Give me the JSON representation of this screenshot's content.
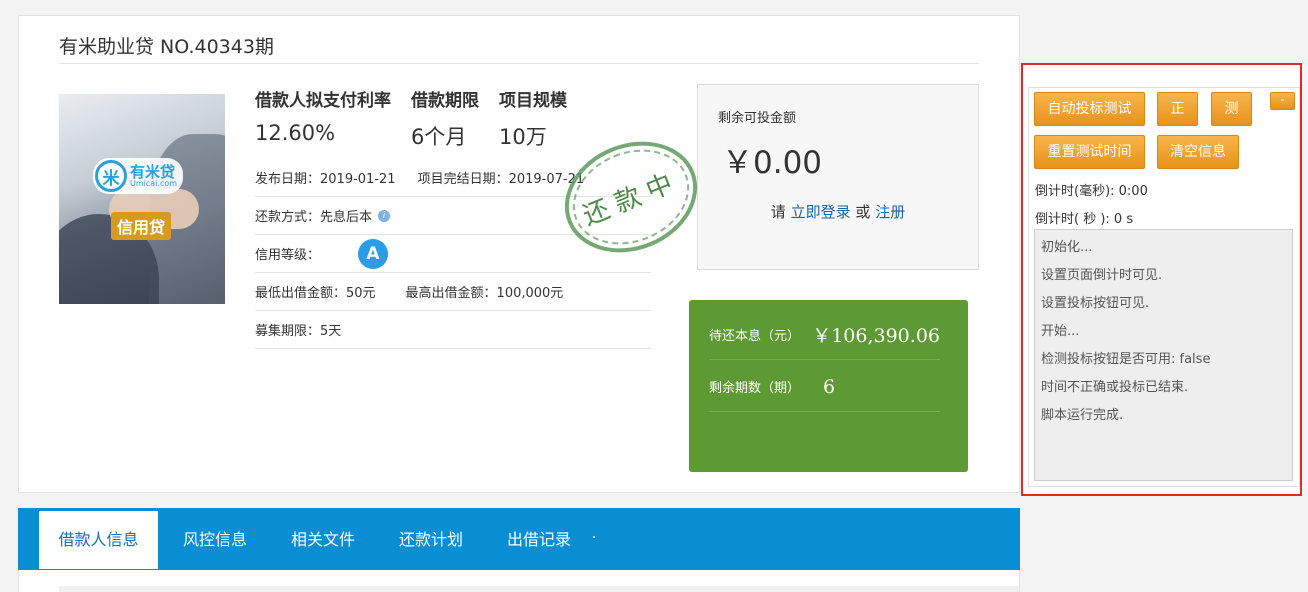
{
  "project": {
    "title": "有米助业贷 NO.40343期",
    "brand_name": "有米贷",
    "brand_url": "Umicai.com",
    "brand_glyph": "米",
    "credit_label": "信用贷",
    "stamp": "还款中"
  },
  "stats": [
    {
      "label": "借款人拟支付利率",
      "value": "12.60%"
    },
    {
      "label": "借款期限",
      "value": "6个月"
    },
    {
      "label": "项目规模",
      "value": "10万"
    }
  ],
  "info": {
    "publish_date": "发布日期：2019-01-21",
    "end_date": "项目完结日期：2019-07-21",
    "repay_method": "还款方式：先息后本",
    "info_icon": "i",
    "credit_grade_label": "信用等级：",
    "credit_grade": "A",
    "min_amount": "最低出借金额：50元",
    "max_amount": "最高出借金额：100,000元",
    "raise_period": "募集期限：5天"
  },
  "invest": {
    "remaining_label": "剩余可投金额",
    "remaining_amount": "￥0.00",
    "login_prefix": "请",
    "login_link": "立即登录",
    "or": "或",
    "register_link": "注册"
  },
  "repay": {
    "pending_label": "待还本息（元）",
    "pending_value": "￥106,390.06",
    "remaining_label": "剩余期数（期）",
    "remaining_value": "6"
  },
  "tabs": [
    "借款人信息",
    "风控信息",
    "相关文件",
    "还款计划",
    "出借记录"
  ],
  "tool_panel": {
    "auto_bid_test": "自动投标测试",
    "btn_zheng": "正",
    "btn_ce": "测",
    "minimize": "-",
    "reset_time": "重置测试时间",
    "clear_info": "清空信息",
    "countdown_ms": "倒计时(毫秒): 0:00",
    "countdown_s": "倒计时( 秒 ): 0 s",
    "log": [
      "初始化...",
      "设置页面倒计时可见.",
      "设置投标按钮可见.",
      "开始...",
      "检测投标按钮是否可用: false",
      "时间不正确或投标已结束.",
      "脚本运行完成."
    ]
  },
  "colors": {
    "accent_blue": "#0a8ed3",
    "repay_green": "#5e9a34",
    "orange_button": "#e9921b",
    "outline_red": "#dd2b2b"
  }
}
